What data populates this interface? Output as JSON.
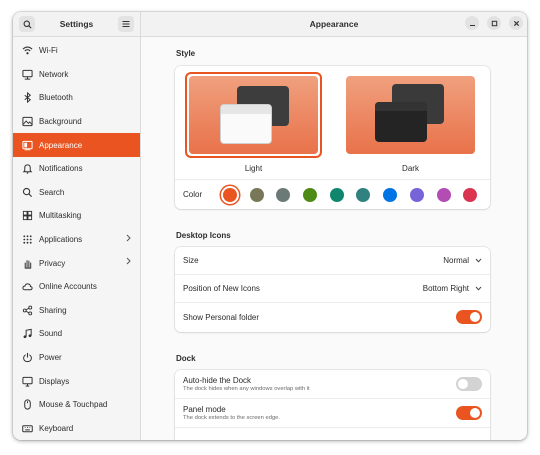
{
  "sidebar": {
    "title": "Settings",
    "items": [
      {
        "label": "Wi-Fi",
        "icon": "wifi-icon",
        "name": "wifi"
      },
      {
        "label": "Network",
        "icon": "network-icon",
        "name": "network"
      },
      {
        "label": "Bluetooth",
        "icon": "bluetooth-icon",
        "name": "bluetooth"
      },
      {
        "label": "Background",
        "icon": "background-icon",
        "name": "background"
      },
      {
        "label": "Appearance",
        "icon": "appearance-icon",
        "name": "appearance"
      },
      {
        "label": "Notifications",
        "icon": "bell-icon",
        "name": "notifications"
      },
      {
        "label": "Search",
        "icon": "search-icon",
        "name": "search"
      },
      {
        "label": "Multitasking",
        "icon": "multitasking-icon",
        "name": "multitasking"
      },
      {
        "label": "Applications",
        "icon": "applications-icon",
        "name": "applications"
      },
      {
        "label": "Privacy",
        "icon": "hand-icon",
        "name": "privacy"
      },
      {
        "label": "Online Accounts",
        "icon": "cloud-icon",
        "name": "online-accounts"
      },
      {
        "label": "Sharing",
        "icon": "share-icon",
        "name": "sharing"
      },
      {
        "label": "Sound",
        "icon": "music-note-icon",
        "name": "sound"
      },
      {
        "label": "Power",
        "icon": "power-icon",
        "name": "power"
      },
      {
        "label": "Displays",
        "icon": "display-icon",
        "name": "displays"
      },
      {
        "label": "Mouse & Touchpad",
        "icon": "mouse-icon",
        "name": "mouse-touchpad"
      },
      {
        "label": "Keyboard",
        "icon": "keyboard-icon",
        "name": "keyboard"
      }
    ]
  },
  "header": {
    "title": "Appearance"
  },
  "style_section": {
    "title": "Style",
    "themes": [
      {
        "label": "Light",
        "selected": true
      },
      {
        "label": "Dark",
        "selected": false
      }
    ],
    "color_label": "Color",
    "colors": [
      "#e95420",
      "#787859",
      "#6c7a77",
      "#4e8a16",
      "#10866e",
      "#308280",
      "#0073e5",
      "#7764d8",
      "#b34cb3",
      "#da3450"
    ],
    "selected_color": "#e95420"
  },
  "desktop_icons": {
    "title": "Desktop Icons",
    "size_label": "Size",
    "size_value": "Normal",
    "position_label": "Position of New Icons",
    "position_value": "Bottom Right",
    "personal_label": "Show Personal folder",
    "personal_on": true
  },
  "dock": {
    "title": "Dock",
    "autohide_label": "Auto-hide the Dock",
    "autohide_sub": "The dock hides when any windows overlap with it",
    "autohide_on": false,
    "panel_label": "Panel mode",
    "panel_sub": "The dock extends to the screen edge.",
    "panel_on": true
  },
  "colors": {
    "accent": "#e95420"
  }
}
